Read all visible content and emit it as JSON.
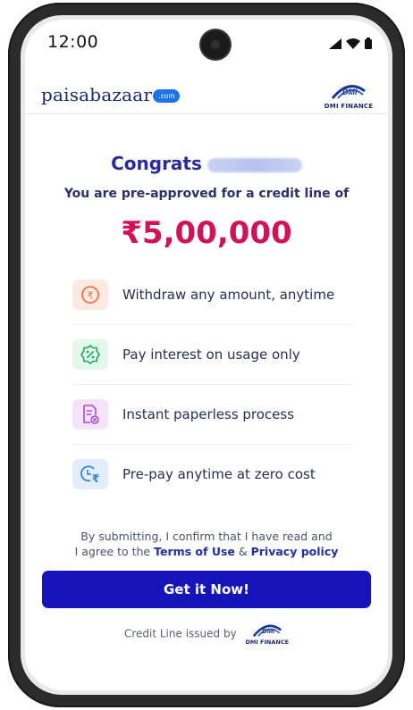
{
  "status_bar": {
    "time": "12:00"
  },
  "header": {
    "brand": "paisabazaar",
    "brand_badge": ".com",
    "partner": "DMI FINANCE"
  },
  "offer": {
    "congrats": "Congrats",
    "preapproved_text": "You are pre-approved for a credit line of",
    "amount": "₹5,00,000"
  },
  "features": [
    {
      "icon": "rupee-icon",
      "text": "Withdraw any amount, anytime",
      "bg": "#fde9e1",
      "color": "#f0754a"
    },
    {
      "icon": "percent-badge-icon",
      "text": "Pay interest on usage only",
      "bg": "#e3f7ea",
      "color": "#1ea862"
    },
    {
      "icon": "paperless-document-icon",
      "text": "Instant paperless process",
      "bg": "#f4e3fa",
      "color": "#b147d6"
    },
    {
      "icon": "clock-rupee-icon",
      "text": "Pre-pay anytime at zero cost",
      "bg": "#e2eefb",
      "color": "#2e82d8"
    }
  ],
  "disclaimer": {
    "line1": "By submitting, I confirm that I have read and",
    "line2_prefix": "I agree to the",
    "terms": "Terms of Use",
    "and": "&",
    "privacy": "Privacy policy"
  },
  "cta": {
    "label": "Get it Now!",
    "color": "#1515b9"
  },
  "footer": {
    "issued_by": "Credit Line issued by",
    "partner": "DMI FINANCE"
  },
  "colors": {
    "amount": "#d1125b",
    "heading": "#2a2aa0",
    "brand": "#1b2a6b"
  }
}
